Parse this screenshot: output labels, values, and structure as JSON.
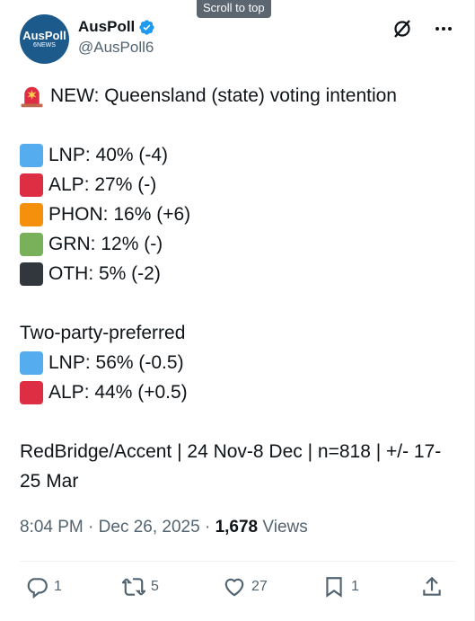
{
  "ui": {
    "scroll_to_top": "Scroll to top"
  },
  "author": {
    "display_name": "AusPoll",
    "handle": "@AusPoll6",
    "avatar_line1": "AusPoll",
    "avatar_line2": "6NEWS",
    "verified": true
  },
  "post": {
    "headline": "NEW: Queensland (state) voting intention",
    "primary": [
      {
        "text": "LNP: 40% (-4)",
        "color": "#55acee"
      },
      {
        "text": "ALP: 27% (-)",
        "color": "#dd2e44"
      },
      {
        "text": "PHON: 16% (+6)",
        "color": "#f4900c"
      },
      {
        "text": "GRN: 12% (-)",
        "color": "#78b159"
      },
      {
        "text": "OTH: 5% (-2)",
        "color": "#31373d"
      }
    ],
    "tpp_heading": "Two-party-preferred",
    "tpp": [
      {
        "text": "LNP: 56% (-0.5)",
        "color": "#55acee"
      },
      {
        "text": "ALP: 44% (+0.5)",
        "color": "#dd2e44"
      }
    ],
    "source": "RedBridge/Accent | 24 Nov-8 Dec | n=818 | +/- 17-25 Mar"
  },
  "meta": {
    "time": "8:04 PM",
    "date": "Dec 26, 2025",
    "views_count": "1,678",
    "views_label": "Views"
  },
  "actions": {
    "replies": "1",
    "reposts": "5",
    "likes": "27",
    "bookmarks": "1"
  },
  "colors": {
    "accent": "#1d9bf0",
    "muted": "#536471"
  }
}
